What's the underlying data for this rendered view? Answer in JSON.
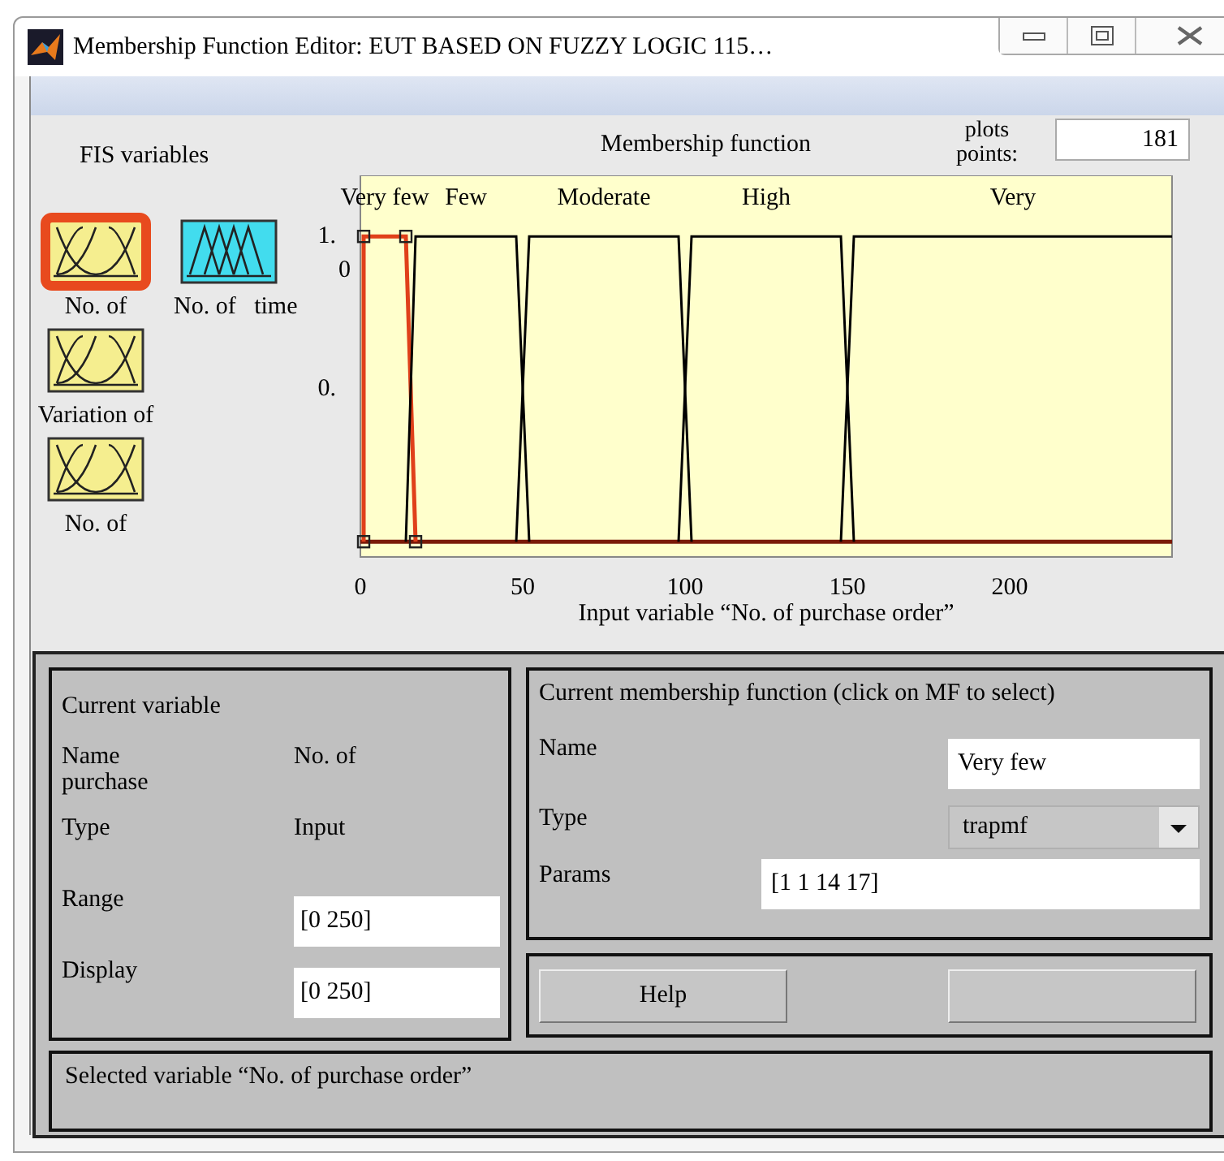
{
  "window": {
    "title": "Membership Function Editor: EUT BASED ON FUZZY LOGIC 115…"
  },
  "fis_variables": {
    "title": "FIS variables",
    "items": [
      {
        "label": "No. of",
        "kind": "input",
        "selected": true
      },
      {
        "label": "No. of   time",
        "kind": "output",
        "selected": false
      },
      {
        "label": "Variation of",
        "kind": "input",
        "selected": false
      },
      {
        "label": "No. of",
        "kind": "input",
        "selected": false
      }
    ]
  },
  "plot": {
    "title": "Membership function",
    "plot_points_label": "plots points:",
    "plot_points": "181",
    "membership_functions": [
      {
        "label": "Very few",
        "selected": true
      },
      {
        "label": "Few",
        "selected": false
      },
      {
        "label": "Moderate",
        "selected": false
      },
      {
        "label": "High",
        "selected": false
      },
      {
        "label": "Very",
        "selected": false
      }
    ],
    "x_tick_labels": [
      "0",
      "50",
      "100",
      "150",
      "200"
    ],
    "y_axis_labels": [
      "1.",
      "0",
      "0."
    ],
    "x_axis_label": "Input variable “No. of purchase order”"
  },
  "current_variable": {
    "title": "Current variable",
    "rows": [
      {
        "kind": "text",
        "label": "Name",
        "value": "No. of",
        "note": "purchase"
      },
      {
        "kind": "text",
        "label": "Type",
        "value": "Input"
      },
      {
        "kind": "field",
        "label": "Range",
        "value": "[0 250]"
      },
      {
        "kind": "field",
        "label": "Display",
        "value": "[0 250]"
      }
    ]
  },
  "current_mf": {
    "title": "Current membership function (click on MF to select)",
    "name_label": "Name",
    "name": "Very few",
    "type_label": "Type",
    "type": "trapmf",
    "params_label": "Params",
    "params": "[1 1 14 17]"
  },
  "buttons": [
    {
      "kind": "labeled",
      "label": "Help"
    },
    {
      "kind": "blank"
    }
  ],
  "status_bar": "Selected variable “No. of purchase order”"
}
